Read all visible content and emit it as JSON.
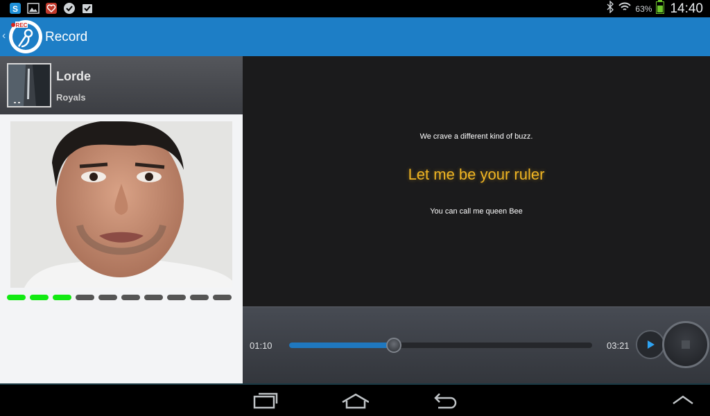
{
  "status_bar": {
    "left_icons": [
      "skype-icon",
      "gallery-icon",
      "heart-app-icon",
      "check-badge-icon",
      "task-icon"
    ],
    "battery_percent": "63%",
    "time": "14:40"
  },
  "action_bar": {
    "title": "Record",
    "logo_label": "REC",
    "accent_color": "#1d7ec6"
  },
  "song": {
    "artist": "Lorde",
    "title": "Royals"
  },
  "level_meter": {
    "segments_total": 10,
    "segments_active": 3,
    "active_color": "#12ea12"
  },
  "lyrics": {
    "previous": "We crave a different kind of buzz.",
    "current": "Let me be your ruler",
    "next": "You can call me queen Bee",
    "highlight_color": "#f0b523"
  },
  "player": {
    "elapsed": "01:10",
    "total": "03:21",
    "progress": 0.345
  }
}
